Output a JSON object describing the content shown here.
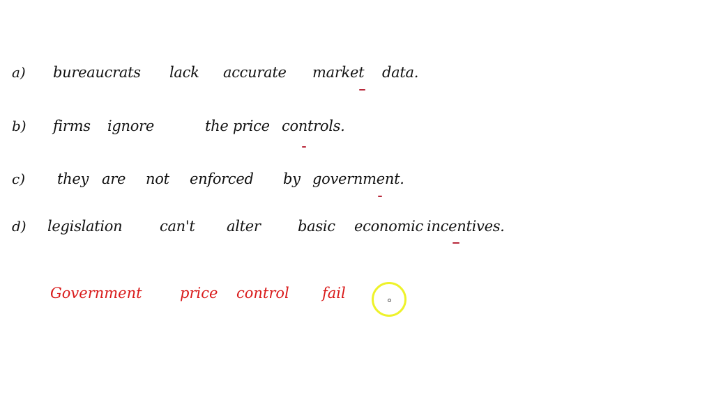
{
  "options": [
    {
      "label": "a)",
      "words": [
        "bureaucrats",
        "lack",
        "accurate",
        "market",
        "data."
      ]
    },
    {
      "label": "b)",
      "words": [
        "firms",
        "ignore",
        "the price",
        "controls."
      ]
    },
    {
      "label": "c)",
      "words": [
        "they",
        "are",
        "not",
        "enforced",
        "by",
        "government."
      ]
    },
    {
      "label": "d)",
      "words": [
        "legislation",
        "can't",
        "alter",
        "basic",
        "economic",
        "incentives."
      ]
    }
  ],
  "answer": {
    "words": [
      "Government",
      "price",
      "control",
      "fail"
    ]
  },
  "colors": {
    "ink": "#111111",
    "answer_ink": "#d91a1a",
    "tick_mark": "#b8283a",
    "cursor_highlight": "#eef22a"
  }
}
